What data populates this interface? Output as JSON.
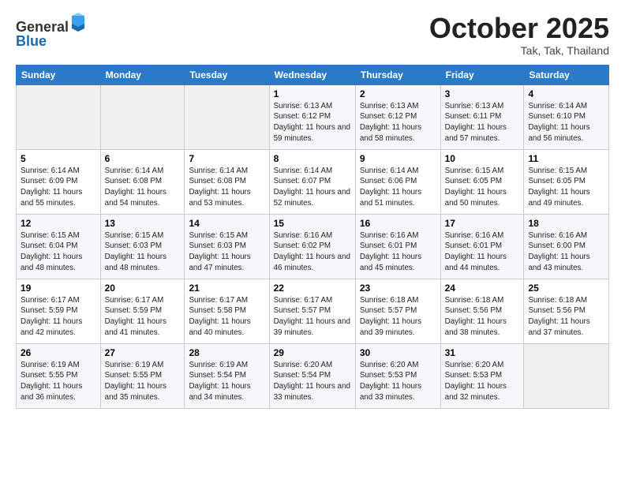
{
  "header": {
    "logo_general": "General",
    "logo_blue": "Blue",
    "month": "October 2025",
    "location": "Tak, Tak, Thailand"
  },
  "days_of_week": [
    "Sunday",
    "Monday",
    "Tuesday",
    "Wednesday",
    "Thursday",
    "Friday",
    "Saturday"
  ],
  "weeks": [
    [
      {
        "day": "",
        "info": ""
      },
      {
        "day": "",
        "info": ""
      },
      {
        "day": "",
        "info": ""
      },
      {
        "day": "1",
        "info": "Sunrise: 6:13 AM\nSunset: 6:12 PM\nDaylight: 11 hours and 59 minutes."
      },
      {
        "day": "2",
        "info": "Sunrise: 6:13 AM\nSunset: 6:12 PM\nDaylight: 11 hours and 58 minutes."
      },
      {
        "day": "3",
        "info": "Sunrise: 6:13 AM\nSunset: 6:11 PM\nDaylight: 11 hours and 57 minutes."
      },
      {
        "day": "4",
        "info": "Sunrise: 6:14 AM\nSunset: 6:10 PM\nDaylight: 11 hours and 56 minutes."
      }
    ],
    [
      {
        "day": "5",
        "info": "Sunrise: 6:14 AM\nSunset: 6:09 PM\nDaylight: 11 hours and 55 minutes."
      },
      {
        "day": "6",
        "info": "Sunrise: 6:14 AM\nSunset: 6:08 PM\nDaylight: 11 hours and 54 minutes."
      },
      {
        "day": "7",
        "info": "Sunrise: 6:14 AM\nSunset: 6:08 PM\nDaylight: 11 hours and 53 minutes."
      },
      {
        "day": "8",
        "info": "Sunrise: 6:14 AM\nSunset: 6:07 PM\nDaylight: 11 hours and 52 minutes."
      },
      {
        "day": "9",
        "info": "Sunrise: 6:14 AM\nSunset: 6:06 PM\nDaylight: 11 hours and 51 minutes."
      },
      {
        "day": "10",
        "info": "Sunrise: 6:15 AM\nSunset: 6:05 PM\nDaylight: 11 hours and 50 minutes."
      },
      {
        "day": "11",
        "info": "Sunrise: 6:15 AM\nSunset: 6:05 PM\nDaylight: 11 hours and 49 minutes."
      }
    ],
    [
      {
        "day": "12",
        "info": "Sunrise: 6:15 AM\nSunset: 6:04 PM\nDaylight: 11 hours and 48 minutes."
      },
      {
        "day": "13",
        "info": "Sunrise: 6:15 AM\nSunset: 6:03 PM\nDaylight: 11 hours and 48 minutes."
      },
      {
        "day": "14",
        "info": "Sunrise: 6:15 AM\nSunset: 6:03 PM\nDaylight: 11 hours and 47 minutes."
      },
      {
        "day": "15",
        "info": "Sunrise: 6:16 AM\nSunset: 6:02 PM\nDaylight: 11 hours and 46 minutes."
      },
      {
        "day": "16",
        "info": "Sunrise: 6:16 AM\nSunset: 6:01 PM\nDaylight: 11 hours and 45 minutes."
      },
      {
        "day": "17",
        "info": "Sunrise: 6:16 AM\nSunset: 6:01 PM\nDaylight: 11 hours and 44 minutes."
      },
      {
        "day": "18",
        "info": "Sunrise: 6:16 AM\nSunset: 6:00 PM\nDaylight: 11 hours and 43 minutes."
      }
    ],
    [
      {
        "day": "19",
        "info": "Sunrise: 6:17 AM\nSunset: 5:59 PM\nDaylight: 11 hours and 42 minutes."
      },
      {
        "day": "20",
        "info": "Sunrise: 6:17 AM\nSunset: 5:59 PM\nDaylight: 11 hours and 41 minutes."
      },
      {
        "day": "21",
        "info": "Sunrise: 6:17 AM\nSunset: 5:58 PM\nDaylight: 11 hours and 40 minutes."
      },
      {
        "day": "22",
        "info": "Sunrise: 6:17 AM\nSunset: 5:57 PM\nDaylight: 11 hours and 39 minutes."
      },
      {
        "day": "23",
        "info": "Sunrise: 6:18 AM\nSunset: 5:57 PM\nDaylight: 11 hours and 39 minutes."
      },
      {
        "day": "24",
        "info": "Sunrise: 6:18 AM\nSunset: 5:56 PM\nDaylight: 11 hours and 38 minutes."
      },
      {
        "day": "25",
        "info": "Sunrise: 6:18 AM\nSunset: 5:56 PM\nDaylight: 11 hours and 37 minutes."
      }
    ],
    [
      {
        "day": "26",
        "info": "Sunrise: 6:19 AM\nSunset: 5:55 PM\nDaylight: 11 hours and 36 minutes."
      },
      {
        "day": "27",
        "info": "Sunrise: 6:19 AM\nSunset: 5:55 PM\nDaylight: 11 hours and 35 minutes."
      },
      {
        "day": "28",
        "info": "Sunrise: 6:19 AM\nSunset: 5:54 PM\nDaylight: 11 hours and 34 minutes."
      },
      {
        "day": "29",
        "info": "Sunrise: 6:20 AM\nSunset: 5:54 PM\nDaylight: 11 hours and 33 minutes."
      },
      {
        "day": "30",
        "info": "Sunrise: 6:20 AM\nSunset: 5:53 PM\nDaylight: 11 hours and 33 minutes."
      },
      {
        "day": "31",
        "info": "Sunrise: 6:20 AM\nSunset: 5:53 PM\nDaylight: 11 hours and 32 minutes."
      },
      {
        "day": "",
        "info": ""
      }
    ]
  ]
}
